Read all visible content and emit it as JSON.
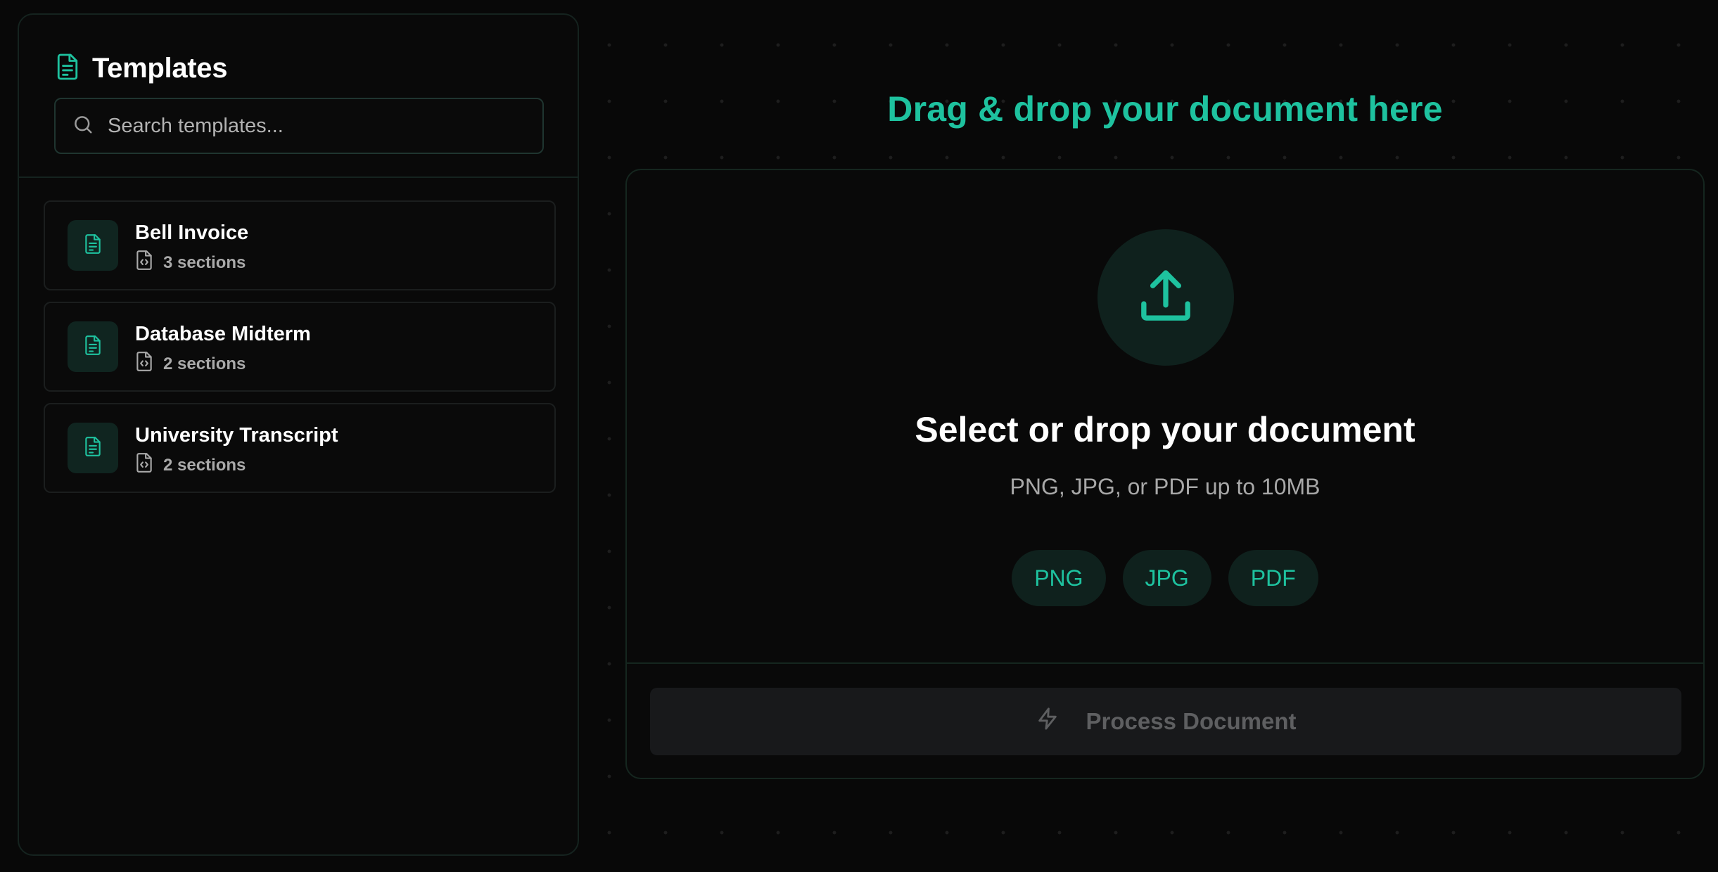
{
  "sidebar": {
    "title": "Templates",
    "search": {
      "placeholder": "Search templates...",
      "value": ""
    },
    "templates": [
      {
        "name": "Bell Invoice",
        "sections": "3 sections"
      },
      {
        "name": "Database Midterm",
        "sections": "2 sections"
      },
      {
        "name": "University Transcript",
        "sections": "2 sections"
      }
    ]
  },
  "main": {
    "drop_title": "Drag & drop your document here",
    "dropzone": {
      "heading": "Select or drop your document",
      "subtext": "PNG, JPG, or PDF up to 10MB",
      "formats": [
        "PNG",
        "JPG",
        "PDF"
      ]
    },
    "process_button": {
      "label": "Process Document",
      "disabled": true
    }
  },
  "icons": {
    "title": "file-text-icon",
    "search": "search-icon",
    "card": "file-text-icon",
    "sections": "file-code-icon",
    "upload": "upload-icon",
    "process": "zap-icon"
  },
  "colors": {
    "accent": "#1ec29f",
    "accent_bg": "#0f211d",
    "background": "#080808",
    "panel_border": "#15231f",
    "muted_text": "#a8a8a8",
    "disabled_button_bg": "#18191b",
    "disabled_button_text": "#5e5f61"
  }
}
